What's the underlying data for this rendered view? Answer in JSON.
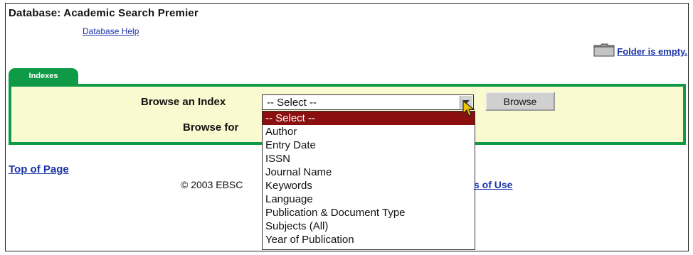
{
  "header": {
    "database_title": "Database: Academic Search Premier",
    "database_help": "Database Help",
    "folder_status": "Folder is empty."
  },
  "tabs": [
    {
      "label": "Indexes",
      "active": true
    }
  ],
  "browse": {
    "browse_index_label": "Browse an Index",
    "browse_for_label": "Browse for",
    "select_value": "-- Select --",
    "browse_button": "Browse",
    "options": [
      "-- Select --",
      "Author",
      "Entry Date",
      "ISSN",
      "Journal Name",
      "Keywords",
      "Language",
      "Publication & Document Type",
      "Subjects (All)",
      "Year of Publication"
    ],
    "highlighted_option": "-- Select --"
  },
  "footer": {
    "top_of_page": "Top of Page",
    "copyright": "© 2003 EBSC",
    "terms": "s of Use"
  },
  "icons": {
    "folder": "folder-icon",
    "dropdown_arrow": "chevron-down-icon",
    "cursor": "pointer-cursor-icon"
  },
  "colors": {
    "tab_green": "#0f9a47",
    "panel_yellow": "#fafad0",
    "link_blue": "#1a33a8",
    "selected_red": "#8b0f0f"
  }
}
